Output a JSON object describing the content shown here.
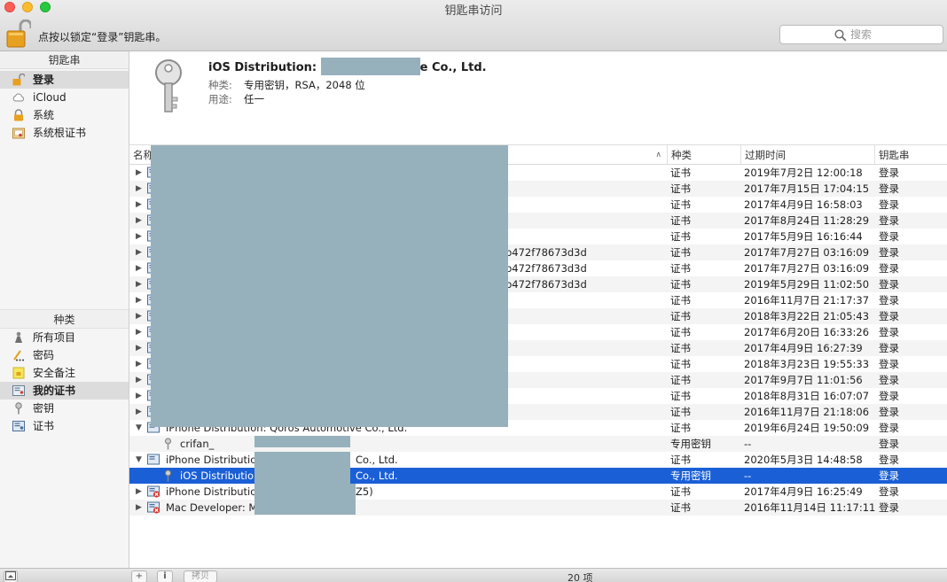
{
  "window": {
    "title": "钥匙串访问"
  },
  "toolbar": {
    "lock_hint": "点按以锁定“登录”钥匙串。",
    "search_placeholder": "搜索"
  },
  "sidebar": {
    "keychains_header": "钥匙串",
    "keychains": [
      {
        "label": "登录",
        "icon": "lock-open-icon",
        "selected": true
      },
      {
        "label": "iCloud",
        "icon": "cloud-icon",
        "selected": false
      },
      {
        "label": "系统",
        "icon": "lock-icon",
        "selected": false
      },
      {
        "label": "系统根证书",
        "icon": "certificate-folder-icon",
        "selected": false
      }
    ],
    "category_header": "种类",
    "categories": [
      {
        "label": "所有项目",
        "icon": "all-items-icon",
        "selected": false
      },
      {
        "label": "密码",
        "icon": "password-icon",
        "selected": false
      },
      {
        "label": "安全备注",
        "icon": "secure-note-icon",
        "selected": false
      },
      {
        "label": "我的证书",
        "icon": "my-certificate-icon",
        "selected": true
      },
      {
        "label": "密钥",
        "icon": "key-icon",
        "selected": false
      },
      {
        "label": "证书",
        "icon": "certificate-icon",
        "selected": false
      }
    ]
  },
  "info": {
    "title_prefix": "iOS Distribution:",
    "title_suffix": "e Co., Ltd.",
    "kind_label": "种类:",
    "kind_value": "专用密钥，RSA，2048 位",
    "usage_label": "用途:",
    "usage_value": "任一"
  },
  "table": {
    "columns": {
      "name": "名称",
      "kind": "种类",
      "expires": "过期时间",
      "keychain": "钥匙串"
    },
    "rows": [
      {
        "name": "",
        "kind": "证书",
        "expires": "2019年7月2日 12:00:18",
        "keychain": "登录",
        "tri": "▶",
        "icon": "certificate"
      },
      {
        "name": "",
        "kind": "证书",
        "expires": "2017年7月15日 17:04:15",
        "keychain": "登录",
        "tri": "▶",
        "icon": "certificate"
      },
      {
        "name": "",
        "kind": "证书",
        "expires": "2017年4月9日 16:58:03",
        "keychain": "登录",
        "tri": "▶",
        "icon": "certificate"
      },
      {
        "name": "",
        "kind": "证书",
        "expires": "2017年8月24日 11:28:29",
        "keychain": "登录",
        "tri": "▶",
        "icon": "certificate"
      },
      {
        "name": "",
        "kind": "证书",
        "expires": "2017年5月9日 16:16:44",
        "keychain": "登录",
        "tri": "▶",
        "icon": "certificate"
      },
      {
        "name": "b472f78673d3d",
        "kind": "证书",
        "expires": "2017年7月27日 03:16:09",
        "keychain": "登录",
        "tri": "▶",
        "icon": "certificate",
        "name_offset": true
      },
      {
        "name": "b472f78673d3d",
        "kind": "证书",
        "expires": "2017年7月27日 03:16:09",
        "keychain": "登录",
        "tri": "▶",
        "icon": "certificate",
        "name_offset": true
      },
      {
        "name": "b472f78673d3d",
        "kind": "证书",
        "expires": "2019年5月29日 11:02:50",
        "keychain": "登录",
        "tri": "▶",
        "icon": "certificate",
        "name_offset": true
      },
      {
        "name": "",
        "kind": "证书",
        "expires": "2016年11月7日 21:17:37",
        "keychain": "登录",
        "tri": "▶",
        "icon": "certificate"
      },
      {
        "name": "",
        "kind": "证书",
        "expires": "2018年3月22日 21:05:43",
        "keychain": "登录",
        "tri": "▶",
        "icon": "certificate"
      },
      {
        "name": "",
        "kind": "证书",
        "expires": "2017年6月20日 16:33:26",
        "keychain": "登录",
        "tri": "▶",
        "icon": "certificate"
      },
      {
        "name": "",
        "kind": "证书",
        "expires": "2017年4月9日 16:27:39",
        "keychain": "登录",
        "tri": "▶",
        "icon": "certificate"
      },
      {
        "name": "",
        "kind": "证书",
        "expires": "2018年3月23日 19:55:33",
        "keychain": "登录",
        "tri": "▶",
        "icon": "certificate"
      },
      {
        "name": "",
        "kind": "证书",
        "expires": "2017年9月7日 11:01:56",
        "keychain": "登录",
        "tri": "▶",
        "icon": "certificate"
      },
      {
        "name": "",
        "kind": "证书",
        "expires": "2018年8月31日 16:07:07",
        "keychain": "登录",
        "tri": "▶",
        "icon": "certificate"
      },
      {
        "name": "",
        "kind": "证书",
        "expires": "2016年11月7日 21:18:06",
        "keychain": "登录",
        "tri": "▶",
        "icon": "certificate"
      },
      {
        "name": "iPhone Distribution: Qoros Automotive Co., Ltd.",
        "kind": "证书",
        "expires": "2019年6月24日 19:50:09",
        "keychain": "登录",
        "tri": "▼",
        "icon": "certificate"
      },
      {
        "name": "crifan_",
        "kind": "专用密钥",
        "expires": "--",
        "keychain": "登录",
        "tri": "",
        "icon": "key",
        "child": true
      },
      {
        "name": "iPhone Distribution:",
        "name_tail": "Co., Ltd.",
        "kind": "证书",
        "expires": "2020年5月3日 14:48:58",
        "keychain": "登录",
        "tri": "▼",
        "icon": "certificate"
      },
      {
        "name": "iOS Distribution:",
        "name_tail": "Co., Ltd.",
        "kind": "专用密钥",
        "expires": "--",
        "keychain": "登录",
        "tri": "",
        "icon": "key",
        "child": true,
        "selected": true
      },
      {
        "name": "iPhone Distribution",
        "name_tail": "Z5)",
        "kind": "证书",
        "expires": "2017年4月9日 16:25:49",
        "keychain": "登录",
        "tri": "▶",
        "icon": "certificate-invalid"
      },
      {
        "name": "Mac Developer: Ma",
        "kind": "证书",
        "expires": "2016年11月14日 11:17:11",
        "keychain": "登录",
        "tri": "▶",
        "icon": "certificate-invalid"
      }
    ]
  },
  "bottombar": {
    "add": "+",
    "info": "i",
    "copy": "拷贝",
    "count": "20 项"
  },
  "colors": {
    "selection": "#1a5fd6",
    "redaction": "#97b1bc"
  }
}
